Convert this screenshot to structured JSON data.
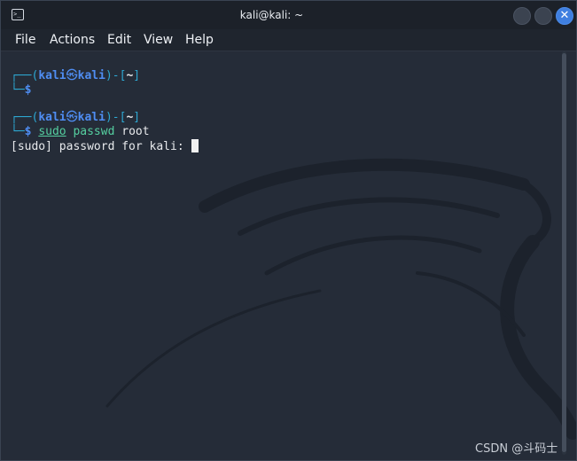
{
  "window": {
    "title": "kali@kali: ~",
    "icon": "terminal-icon",
    "controls": [
      "minimize-button",
      "maximize-button",
      "close-button"
    ],
    "close_glyph": "✕"
  },
  "menubar": {
    "file": "File",
    "actions": "Actions",
    "edit": "Edit",
    "view": "View",
    "help": "Help"
  },
  "terminal": {
    "prompt1": {
      "frame_top": "┌──(",
      "user": "kali",
      "skull": "㉿",
      "host": "kali",
      "bracket_mid": ")-[",
      "dir": "~",
      "bracket_end": "]",
      "frame_bottom": "└─",
      "dollar": "$"
    },
    "prompt2": {
      "frame_top": "┌──(",
      "user": "kali",
      "skull": "㉿",
      "host": "kali",
      "bracket_mid": ")-[",
      "dir": "~",
      "bracket_end": "]",
      "frame_bottom": "└─",
      "dollar": "$",
      "command": "sudo",
      "arg1": "passwd",
      "arg2": "root"
    },
    "output": "[sudo] password for kali: "
  },
  "watermark": "CSDN @斗码士",
  "colors": {
    "background": "#252c38",
    "titlebar": "#1c2129",
    "prompt_frame": "#2da7d1",
    "prompt_user": "#4f8df2",
    "command": "#55cfa0",
    "close_button": "#3f7fe0"
  }
}
